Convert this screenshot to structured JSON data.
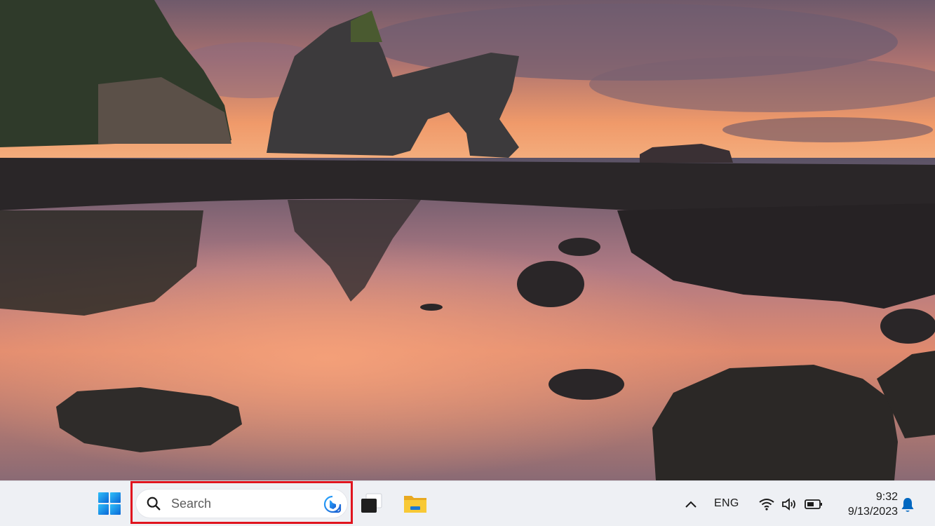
{
  "desktop": {
    "wallpaper": "sunset-rock-arch-beach"
  },
  "taskbar": {
    "start_icon": "windows-logo-icon",
    "search": {
      "placeholder": "Search",
      "icon": "search-icon",
      "bing_icon": "bing-icon",
      "highlight_color": "#e0141e"
    },
    "pinned": [
      {
        "name": "task-view",
        "icon": "task-view-icon"
      },
      {
        "name": "file-explorer",
        "icon": "folder-icon"
      }
    ],
    "tray": {
      "chevron_icon": "chevron-up-icon",
      "language": "ENG",
      "wifi_icon": "wifi-icon",
      "volume_icon": "volume-icon",
      "battery_icon": "battery-icon",
      "time": "9:32",
      "date": "9/13/2023",
      "notification_icon": "bell-icon",
      "accent_color": "#0067c0"
    }
  }
}
